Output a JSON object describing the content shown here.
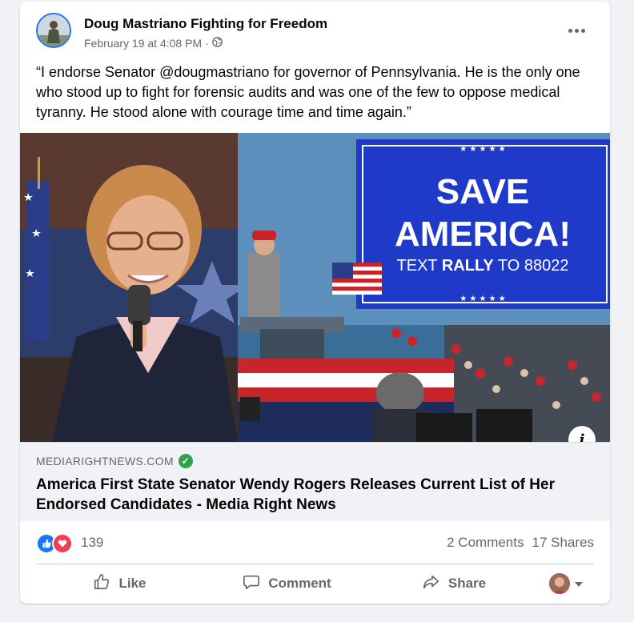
{
  "post": {
    "page_name": "Doug Mastriano Fighting for Freedom",
    "timestamp": "February 19 at 4:08 PM",
    "separator": "·",
    "privacy_icon": "globe-icon",
    "text": "“I endorse Senator @dougmastriano for governor of Pennsylvania. He is the only one who stood up to fight for forensic audits and was one of the few to oppose medical tyranny. He stood alone with courage time and time again.”"
  },
  "image": {
    "sign_title_1": "SAVE",
    "sign_title_2": "AMERICA!",
    "sign_text_pre": "TEXT ",
    "sign_text_bold": "RALLY",
    "sign_text_post": " TO 88022",
    "stars": "★ ★ ★ ★ ★",
    "info_label": "i"
  },
  "link": {
    "domain": "MEDIARIGHTNEWS.COM",
    "title": "America First State Senator Wendy Rogers Releases Current List of Her Endorsed Candidates - Media Right News"
  },
  "stats": {
    "reaction_count": "139",
    "comments": "2 Comments",
    "shares": "17 Shares"
  },
  "actions": {
    "like": "Like",
    "comment": "Comment",
    "share": "Share"
  },
  "colors": {
    "accent": "#1877f2",
    "love": "#f33e58",
    "verified": "#31a24c",
    "sign_blue": "#1f3ac9"
  }
}
